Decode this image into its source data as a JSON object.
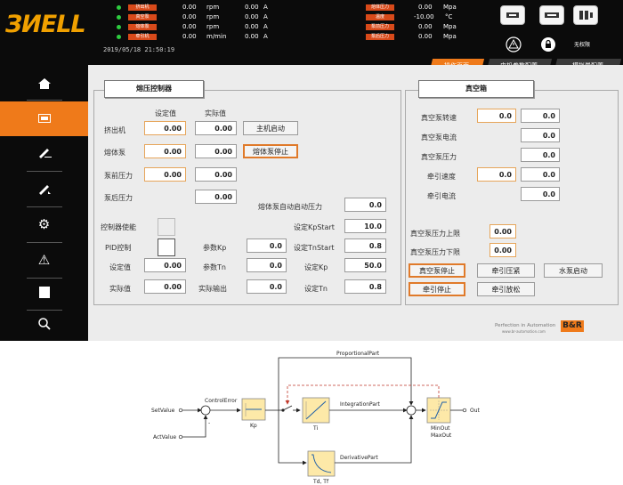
{
  "logo": {
    "text": "ЗИЕLL"
  },
  "status": {
    "rows": [
      {
        "tag": "挤出机",
        "value": "0.00",
        "unit": "rpm",
        "amp": "0.00",
        "amp_unit": "A"
      },
      {
        "tag": "真空泵",
        "value": "0.00",
        "unit": "rpm",
        "amp": "0.00",
        "amp_unit": "A"
      },
      {
        "tag": "熔体泵",
        "value": "0.00",
        "unit": "rpm",
        "amp": "0.00",
        "amp_unit": "A"
      },
      {
        "tag": "牵引机",
        "value": "0.00",
        "unit": "m/min",
        "amp": "0.00",
        "amp_unit": "A"
      }
    ],
    "right_rows": [
      {
        "tag": "熔体压力",
        "value": "0.00",
        "unit": "Mpa"
      },
      {
        "tag": "温度",
        "value": "-10.00",
        "unit": "°C"
      },
      {
        "tag": "泵前压力",
        "value": "0.00",
        "unit": "Mpa"
      },
      {
        "tag": "泵后压力",
        "value": "0.00",
        "unit": "Mpa"
      }
    ],
    "datetime": "2019/05/18  21:50:19",
    "no_permission": "无权限"
  },
  "tabs": [
    "操作页面",
    "电机参数配置",
    "模拟量配置"
  ],
  "sidebar": [
    "home-icon",
    "screen-icon",
    "edit-icon",
    "pen-icon",
    "settings-icon",
    "warning-icon",
    "document-icon",
    "search-icon"
  ],
  "melt": {
    "title": "熔压控制器",
    "col_set": "设定值",
    "col_actual": "实际值",
    "extruder": {
      "label": "挤出机",
      "set": "0.00",
      "actual": "0.00",
      "button": "主机启动"
    },
    "meltpump": {
      "label": "熔体泵",
      "set": "0.00",
      "actual": "0.00",
      "button": "熔体泵停止"
    },
    "pre_pressure": {
      "label": "泵前压力",
      "set": "0.00",
      "actual": "0.00"
    },
    "post_pressure": {
      "label": "泵后压力",
      "actual": "0.00"
    },
    "auto_start_pressure": {
      "label": "熔体泵自动启动压力",
      "value": "0.0"
    },
    "controller_enable": "控制器使能",
    "pid_control": "PID控制",
    "set_kpstart": {
      "label": "设定KpStart",
      "value": "10.0"
    },
    "param_kp": {
      "label": "参数Kp",
      "value": "0.0"
    },
    "set_tnstart": {
      "label": "设定TnStart",
      "value": "0.8"
    },
    "setpoint": {
      "label": "设定值",
      "value": "0.00"
    },
    "param_tn": {
      "label": "参数Tn",
      "value": "0.0"
    },
    "set_kp": {
      "label": "设定Kp",
      "value": "50.0"
    },
    "actual": {
      "label": "实际值",
      "value": "0.00"
    },
    "actual_output": {
      "label": "实际输出",
      "value": "0.0"
    },
    "set_tn": {
      "label": "设定Tn",
      "value": "0.8"
    }
  },
  "vacuum": {
    "title": "真空箱",
    "pump_speed": {
      "label": "真空泵转速",
      "set": "0.0",
      "actual": "0.0"
    },
    "pump_current": {
      "label": "真空泵电流",
      "actual": "0.0"
    },
    "pump_pressure": {
      "label": "真空泵压力",
      "actual": "0.0"
    },
    "traction_speed": {
      "label": "牵引速度",
      "set": "0.0",
      "actual": "0.0"
    },
    "traction_current": {
      "label": "牵引电流",
      "actual": "0.0"
    },
    "upper_limit": {
      "label": "真空泵压力上限",
      "value": "0.00"
    },
    "lower_limit": {
      "label": "真空泵压力下限",
      "value": "0.00"
    },
    "buttons": [
      "真空泵停止",
      "牵引压紧",
      "水泵启动",
      "牵引停止",
      "牵引放松"
    ]
  },
  "footer": {
    "tagline": "Perfection in Automation",
    "url": "www.br-automation.com",
    "brand": "B&R"
  },
  "diagram": {
    "proportional": "ProportionalPart",
    "integration": "IntegrationPart",
    "derivative": "DerivativePart",
    "control_error": "ControlError",
    "set_value": "SetValue",
    "act_value": "ActValue",
    "kp": "Kp",
    "ti": "Ti",
    "td_tf": "Td, Tf",
    "min_out": "MinOut",
    "max_out": "MaxOut",
    "out": "Out",
    "minus": "-"
  }
}
